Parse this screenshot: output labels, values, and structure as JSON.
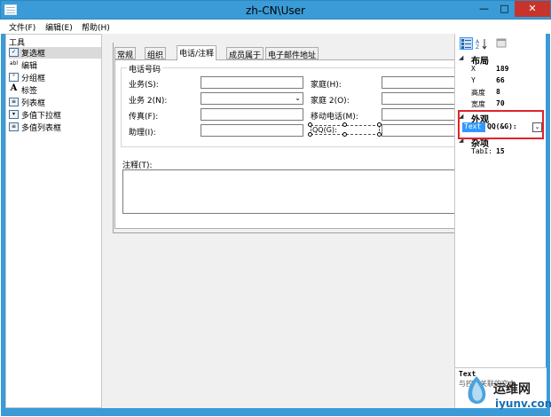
{
  "window": {
    "title": "zh-CN\\User",
    "min_glyph": "—",
    "max_glyph": "□",
    "close_glyph": "✕"
  },
  "menu": {
    "file": "文件(F)",
    "edit": "编辑(E)",
    "help": "帮助(H)"
  },
  "toolbox": {
    "header": "工具",
    "items": [
      {
        "label": "复选框",
        "icon": "checkbox-icon"
      },
      {
        "label": "编辑",
        "icon": "textbox-icon"
      },
      {
        "label": "分组框",
        "icon": "groupbox-icon"
      },
      {
        "label": "标签",
        "icon": "label-icon"
      },
      {
        "label": "列表框",
        "icon": "listbox-icon"
      },
      {
        "label": "多值下拉框",
        "icon": "multi-combo-icon"
      },
      {
        "label": "多值列表框",
        "icon": "multi-listbox-icon"
      }
    ]
  },
  "form": {
    "tabs": [
      "常规",
      "组织",
      "电话/注释",
      "成员属于",
      "电子邮件地址"
    ],
    "active_tab": "电话/注释",
    "phone_group": "电话号码",
    "business": "业务(S):",
    "business2": "业务 2(N):",
    "fax": "传真(F):",
    "assistant": "助理(I):",
    "home": "家庭(H):",
    "home2": "家庭 2(O):",
    "mobile": "移动电话(M):",
    "qq": "QQ(G):",
    "notes": "注释(T):"
  },
  "properties": {
    "layout_category": "布局",
    "x_label": "X",
    "x_value": "189",
    "y_label": "Y",
    "y_value": "66",
    "height_label": "高度",
    "height_value": "8",
    "width_label": "宽度",
    "width_value": "70",
    "appearance_category": "外观",
    "text_label": "Text",
    "text_value": "QQ(&G):",
    "misc_category": "杂项",
    "tabindex_label": "TabI:",
    "tabindex_value": "15",
    "desc_name": "Text",
    "desc_text": "与控件关联的文本"
  },
  "watermark": {
    "line1": "运维网",
    "line2": "iyunv.com"
  },
  "colors": {
    "titlebar": "#3a9bd6",
    "close": "#c7342b",
    "highlight": "#3399ff",
    "redbox": "#e0242b"
  }
}
